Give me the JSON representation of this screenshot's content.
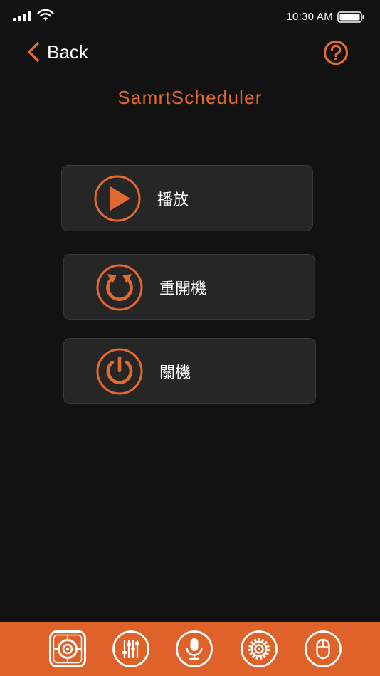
{
  "status_bar": {
    "time": "10:30 AM"
  },
  "nav": {
    "back_label": "Back"
  },
  "page": {
    "title": "SamrtScheduler"
  },
  "actions": [
    {
      "label": "播放",
      "icon": "play-icon"
    },
    {
      "label": "重開機",
      "icon": "restart-icon"
    },
    {
      "label": "關機",
      "icon": "power-icon"
    }
  ],
  "tabbar": {
    "items": [
      {
        "icon": "target-icon",
        "selected": true
      },
      {
        "icon": "equalizer-sliders-icon",
        "selected": false
      },
      {
        "icon": "microphone-icon",
        "selected": false
      },
      {
        "icon": "gear-icon",
        "selected": false
      },
      {
        "icon": "mouse-icon",
        "selected": false
      }
    ]
  },
  "colors": {
    "accent": "#e2692f",
    "background": "#121212",
    "card": "#262626",
    "tabbar": "#e0622b"
  }
}
